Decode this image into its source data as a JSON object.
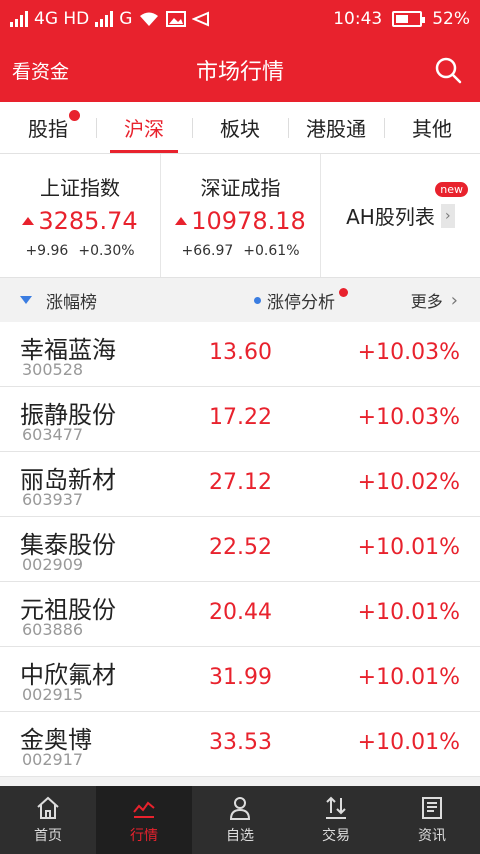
{
  "status_bar": {
    "network": "4G HD",
    "network2": "G",
    "time": "10:43",
    "battery": "52%",
    "battery_level": 0.52
  },
  "header": {
    "left_label": "看资金",
    "title": "市场行情"
  },
  "tabs": [
    {
      "label": "股指",
      "active": false,
      "badge": true
    },
    {
      "label": "沪深",
      "active": true,
      "badge": false
    },
    {
      "label": "板块",
      "active": false,
      "badge": false
    },
    {
      "label": "港股通",
      "active": false,
      "badge": false
    },
    {
      "label": "其他",
      "active": false,
      "badge": false
    }
  ],
  "indices": [
    {
      "name": "上证指数",
      "value": "3285.74",
      "change": "+9.96",
      "percent": "+0.30%"
    },
    {
      "name": "深证成指",
      "value": "10978.18",
      "change": "+66.97",
      "percent": "+0.61%"
    }
  ],
  "ah": {
    "label": "AH股列表",
    "badge": "new"
  },
  "section": {
    "left": "涨幅榜",
    "middle": "涨停分析",
    "right": "更多"
  },
  "stocks": [
    {
      "name": "幸福蓝海",
      "code": "300528",
      "price": "13.60",
      "percent": "+10.03%"
    },
    {
      "name": "振静股份",
      "code": "603477",
      "price": "17.22",
      "percent": "+10.03%"
    },
    {
      "name": "丽岛新材",
      "code": "603937",
      "price": "27.12",
      "percent": "+10.02%"
    },
    {
      "name": "集泰股份",
      "code": "002909",
      "price": "22.52",
      "percent": "+10.01%"
    },
    {
      "name": "元祖股份",
      "code": "603886",
      "price": "20.44",
      "percent": "+10.01%"
    },
    {
      "name": "中欣氟材",
      "code": "002915",
      "price": "31.99",
      "percent": "+10.01%"
    },
    {
      "name": "金奥博",
      "code": "002917",
      "price": "33.53",
      "percent": "+10.01%"
    }
  ],
  "bottom_nav": [
    {
      "label": "首页",
      "icon": "home-icon",
      "active": false
    },
    {
      "label": "行情",
      "icon": "chart-icon",
      "active": true
    },
    {
      "label": "自选",
      "icon": "user-icon",
      "active": false
    },
    {
      "label": "交易",
      "icon": "trade-icon",
      "active": false
    },
    {
      "label": "资讯",
      "icon": "news-icon",
      "active": false
    }
  ],
  "colors": {
    "accent": "#e8222d",
    "nav_bg": "#2e2e2e",
    "blue": "#3b7de1"
  }
}
